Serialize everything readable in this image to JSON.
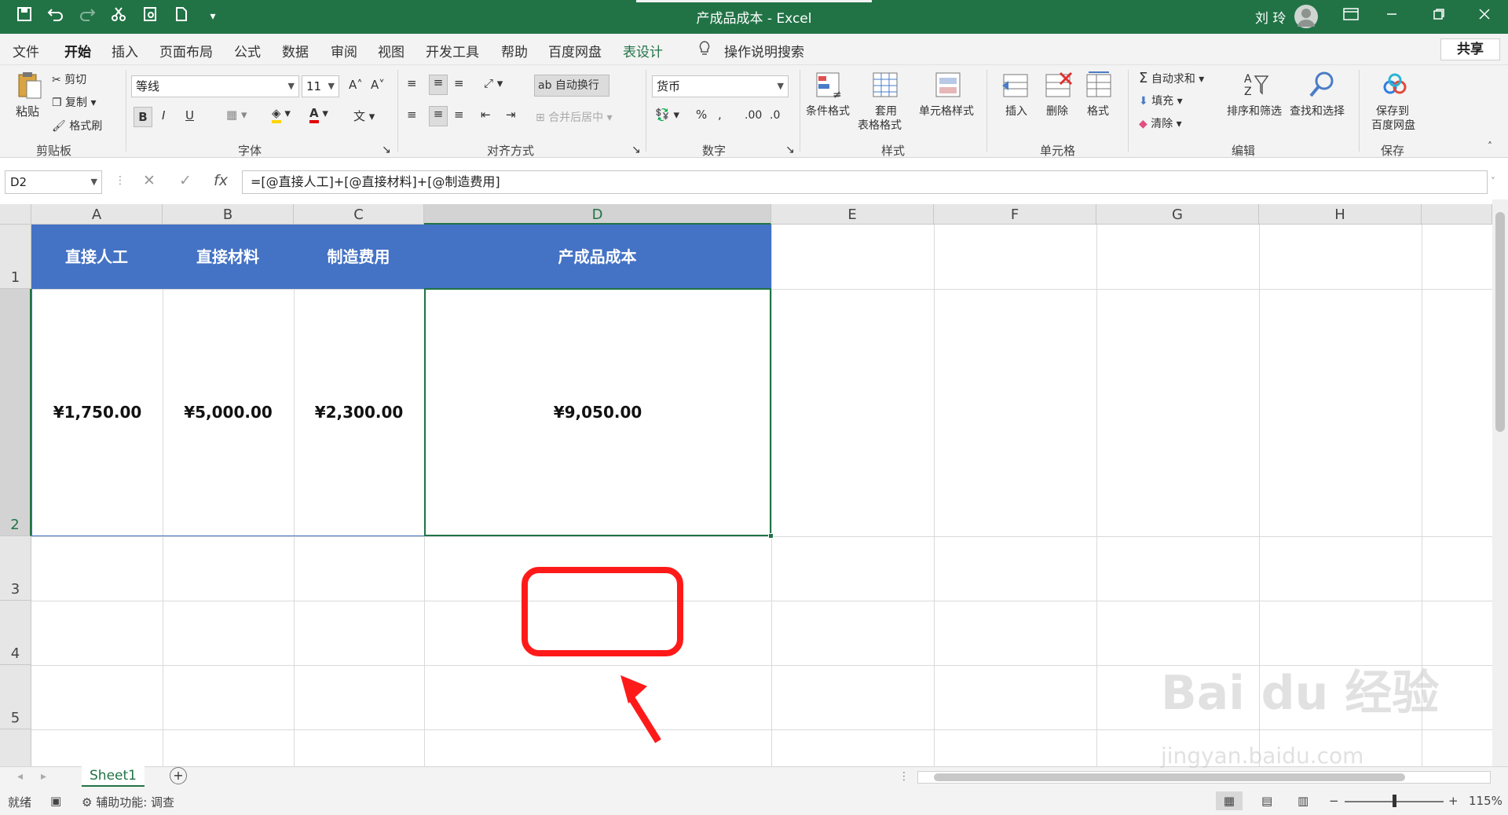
{
  "window": {
    "title": "产成品成本  -  Excel",
    "user": "刘 玲",
    "quick_access": {
      "save": "save-icon",
      "undo": "undo-icon",
      "redo": "redo-icon",
      "cut": "cut-icon",
      "print_preview": "print-preview-icon",
      "new": "new-doc-icon",
      "customize": "customize-icon"
    }
  },
  "menu": {
    "tabs": [
      "文件",
      "开始",
      "插入",
      "页面布局",
      "公式",
      "数据",
      "审阅",
      "视图",
      "开发工具",
      "帮助",
      "百度网盘",
      "表设计"
    ],
    "search": "操作说明搜索",
    "share": "共享"
  },
  "ribbon": {
    "clipboard": {
      "paste": "粘贴",
      "cut": "剪切",
      "copy": "复制",
      "format_painter": "格式刷",
      "group": "剪贴板"
    },
    "font": {
      "name": "等线",
      "size": "11",
      "bold": "B",
      "italic": "I",
      "underline": "U",
      "group": "字体"
    },
    "alignment": {
      "wrap": "自动换行",
      "merge": "合并后居中",
      "group": "对齐方式"
    },
    "number": {
      "format": "货币",
      "percent": "%",
      "group": "数字"
    },
    "styles": {
      "conditional": "条件格式",
      "table_line1": "套用",
      "table_line2": "表格格式",
      "cell_styles": "单元格样式",
      "group": "样式"
    },
    "cells": {
      "insert": "插入",
      "delete": "删除",
      "format": "格式",
      "group": "单元格"
    },
    "editing": {
      "autosum": "自动求和",
      "fill": "填充",
      "clear": "清除",
      "sort": "排序和筛选",
      "find": "查找和选择",
      "group": "编辑"
    },
    "save": {
      "line1": "保存到",
      "line2": "百度网盘",
      "group": "保存"
    }
  },
  "formula_bar": {
    "name_box": "D2",
    "fx": "fx",
    "formula": "=[@直接人工]+[@直接材料]+[@制造费用]"
  },
  "sheet": {
    "columns": [
      "A",
      "B",
      "C",
      "D",
      "E",
      "F",
      "G",
      "H"
    ],
    "rows": [
      "1",
      "2",
      "3",
      "4",
      "5"
    ],
    "headers": [
      "直接人工",
      "直接材料",
      "制造费用",
      "产成品成本"
    ],
    "values": [
      "¥1,750.00",
      "¥5,000.00",
      "¥2,300.00",
      "¥9,050.00"
    ],
    "selected_cell": "D2",
    "tab": "Sheet1",
    "add_sheet": "+"
  },
  "status": {
    "ready": "就绪",
    "accessibility": "辅助功能: 调查",
    "zoom": "115%"
  },
  "watermark": {
    "brand": "Bai du 经验",
    "url": "jingyan.baidu.com"
  },
  "colors": {
    "excel_green": "#217346",
    "table_header": "#4472c4",
    "highlight": "#ff1a1a"
  }
}
